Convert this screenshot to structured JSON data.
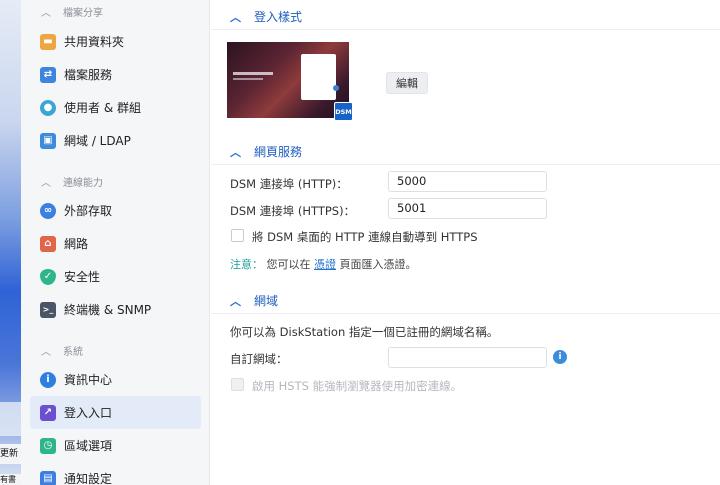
{
  "desktop": {
    "label_b": "更新",
    "label_c": "有書"
  },
  "sidebar": {
    "sections": [
      {
        "title": "檔案分享"
      },
      {
        "title": "連線能力"
      },
      {
        "title": "系統"
      }
    ],
    "items": [
      {
        "label": "共用資料夾",
        "icon": "folder-icon",
        "color": "#f0a640"
      },
      {
        "label": "檔案服務",
        "icon": "file-services-icon",
        "color": "#3d86e0"
      },
      {
        "label": "使用者 & 群組",
        "icon": "users-icon",
        "color": "#3aa6d8"
      },
      {
        "label": "網域 / LDAP",
        "icon": "domain-icon",
        "color": "#3b8ddc"
      },
      {
        "label": "外部存取",
        "icon": "external-access-icon",
        "color": "#3b7fe0"
      },
      {
        "label": "網路",
        "icon": "network-icon",
        "color": "#e1654a"
      },
      {
        "label": "安全性",
        "icon": "security-shield-icon",
        "color": "#2fb58a"
      },
      {
        "label": "終端機 & SNMP",
        "icon": "terminal-icon",
        "color": "#4a5668"
      },
      {
        "label": "資訊中心",
        "icon": "info-center-icon",
        "color": "#2f7fe0"
      },
      {
        "label": "登入入口",
        "icon": "login-portal-icon",
        "color": "#6b4fd0"
      },
      {
        "label": "區域選項",
        "icon": "regional-options-icon",
        "color": "#2fb58a"
      },
      {
        "label": "通知設定",
        "icon": "notification-icon",
        "color": "#3b7fe0"
      }
    ]
  },
  "main": {
    "login_style": {
      "title": "登入樣式",
      "edit_label": "編輯",
      "badge": "DSM"
    },
    "web_services": {
      "title": "網頁服務",
      "http_label": "DSM 連接埠 (HTTP)：",
      "http_value": "5000",
      "https_label": "DSM 連接埠 (HTTPS)：",
      "https_value": "5001",
      "redirect_label": "將 DSM 桌面的 HTTP 連線自動導到 HTTPS",
      "note_prefix": "注意：",
      "note_text_1": "您可以在",
      "note_link": "憑證",
      "note_text_2": "頁面匯入憑證。"
    },
    "domain": {
      "title": "網域",
      "desc": "你可以為 DiskStation 指定一個已註冊的網域名稱。",
      "custom_label": "自訂網域：",
      "custom_value": "",
      "hsts_label": "啟用 HSTS 能強制瀏覽器使用加密連線。"
    }
  }
}
